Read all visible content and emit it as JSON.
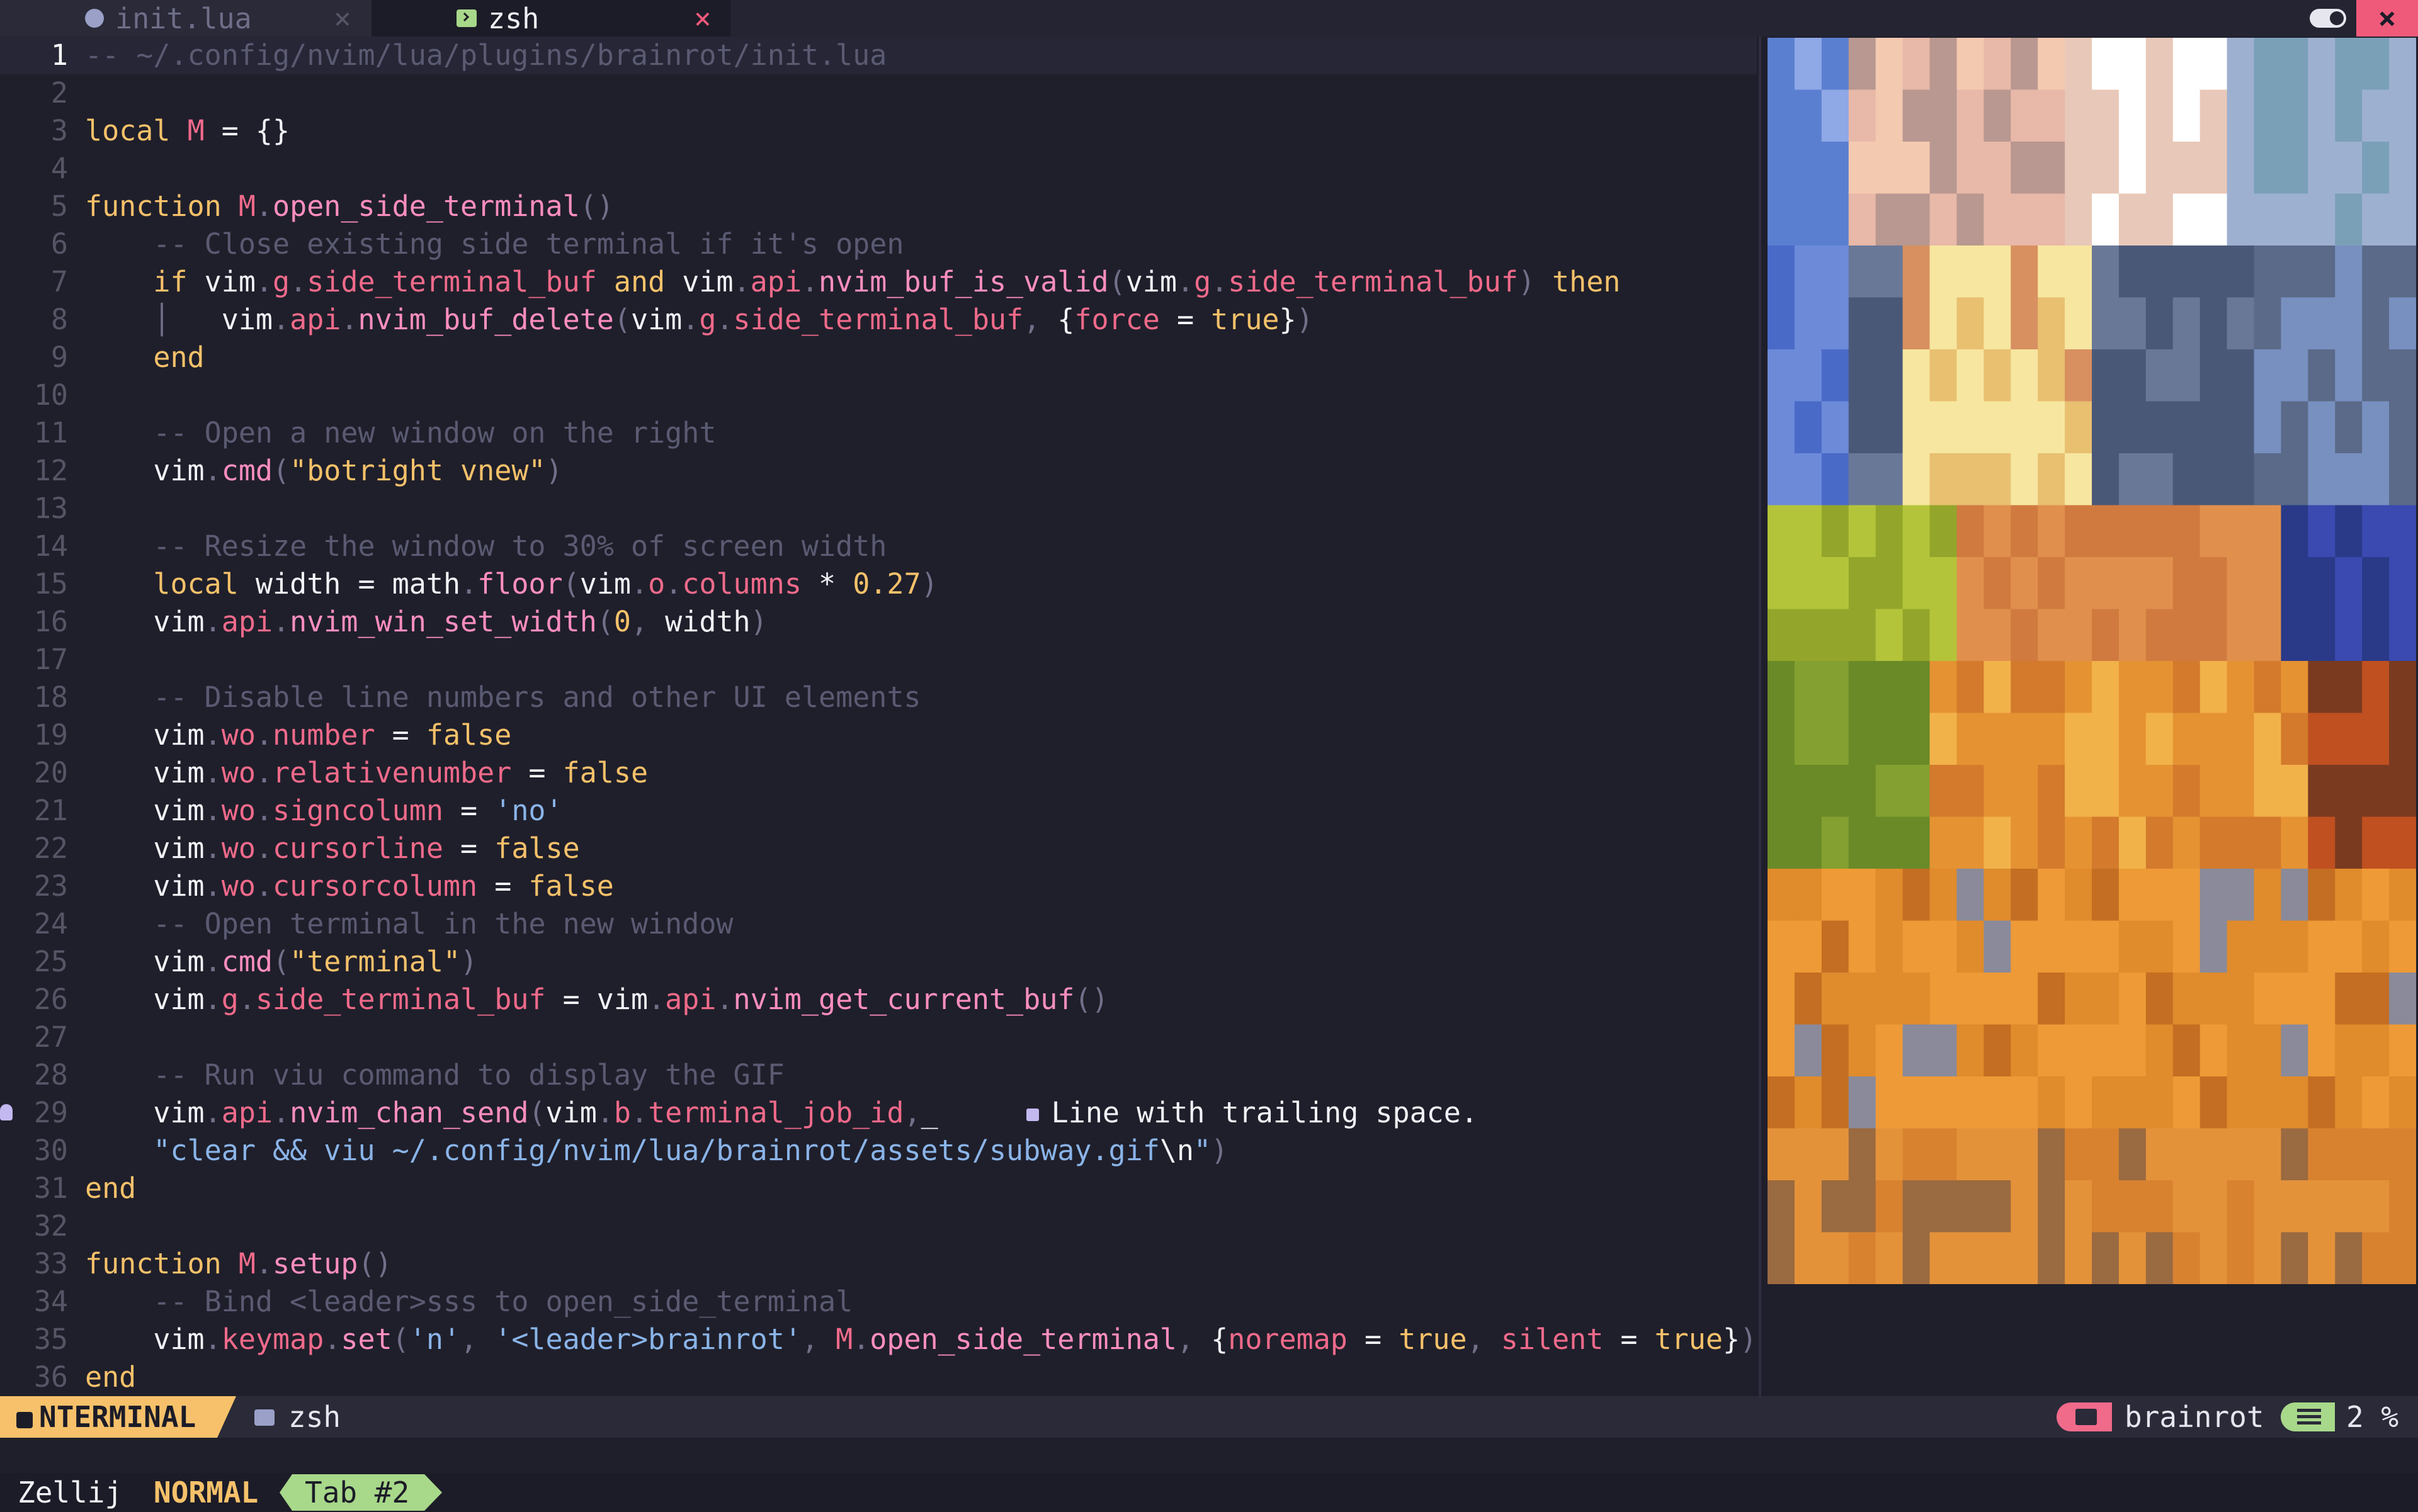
{
  "tabs": [
    {
      "label": "init.lua",
      "icon": "lua-icon",
      "close": "×",
      "active": false
    },
    {
      "label": "zsh",
      "icon": "terminal-icon",
      "close": "×",
      "active": true
    }
  ],
  "window_close": "×",
  "cursor_line": "1",
  "code_lines": [
    {
      "n": "1",
      "tokens": [
        [
          "c",
          "-- ~/.config/nvim/lua/plugins/brainrot/init.lua"
        ]
      ]
    },
    {
      "n": "2",
      "tokens": []
    },
    {
      "n": "3",
      "tokens": [
        [
          "k",
          "local"
        ],
        [
          "i",
          " "
        ],
        [
          "p",
          "M"
        ],
        [
          "i",
          " = {}"
        ]
      ]
    },
    {
      "n": "4",
      "tokens": []
    },
    {
      "n": "5",
      "tokens": [
        [
          "k",
          "function"
        ],
        [
          "i",
          " "
        ],
        [
          "p",
          "M"
        ],
        [
          "b",
          "."
        ],
        [
          "f",
          "open_side_terminal"
        ],
        [
          "b",
          "()"
        ]
      ]
    },
    {
      "n": "6",
      "tokens": [
        [
          "i",
          "    "
        ],
        [
          "c",
          "-- Close existing side terminal if it's open"
        ]
      ]
    },
    {
      "n": "7",
      "tokens": [
        [
          "i",
          "    "
        ],
        [
          "k",
          "if"
        ],
        [
          "i",
          " vim"
        ],
        [
          "b",
          "."
        ],
        [
          "p",
          "g"
        ],
        [
          "b",
          "."
        ],
        [
          "p",
          "side_terminal_buf"
        ],
        [
          "i",
          " "
        ],
        [
          "k",
          "and"
        ],
        [
          "i",
          " vim"
        ],
        [
          "b",
          "."
        ],
        [
          "p",
          "api"
        ],
        [
          "b",
          "."
        ],
        [
          "f",
          "nvim_buf_is_valid"
        ],
        [
          "b",
          "("
        ],
        [
          "i",
          "vim"
        ],
        [
          "b",
          "."
        ],
        [
          "p",
          "g"
        ],
        [
          "b",
          "."
        ],
        [
          "p",
          "side_terminal_buf"
        ],
        [
          "b",
          ")"
        ],
        [
          "i",
          " "
        ],
        [
          "k",
          "then"
        ]
      ]
    },
    {
      "n": "8",
      "tokens": [
        [
          "i",
          "    "
        ],
        [
          "b",
          "│"
        ],
        [
          "i",
          "   vim"
        ],
        [
          "b",
          "."
        ],
        [
          "p",
          "api"
        ],
        [
          "b",
          "."
        ],
        [
          "f",
          "nvim_buf_delete"
        ],
        [
          "b",
          "("
        ],
        [
          "i",
          "vim"
        ],
        [
          "b",
          "."
        ],
        [
          "p",
          "g"
        ],
        [
          "b",
          "."
        ],
        [
          "p",
          "side_terminal_buf"
        ],
        [
          "b",
          ","
        ],
        [
          "i",
          " {"
        ],
        [
          "p",
          "force"
        ],
        [
          "i",
          " = "
        ],
        [
          "k",
          "true"
        ],
        [
          "i",
          "}"
        ],
        [
          "b",
          ")"
        ]
      ]
    },
    {
      "n": "9",
      "tokens": [
        [
          "i",
          "    "
        ],
        [
          "k",
          "end"
        ]
      ]
    },
    {
      "n": "10",
      "tokens": []
    },
    {
      "n": "11",
      "tokens": [
        [
          "i",
          "    "
        ],
        [
          "c",
          "-- Open a new window on the right"
        ]
      ]
    },
    {
      "n": "12",
      "tokens": [
        [
          "i",
          "    vim"
        ],
        [
          "b",
          "."
        ],
        [
          "f",
          "cmd"
        ],
        [
          "b",
          "("
        ],
        [
          "s",
          "\"botright vnew\""
        ],
        [
          "b",
          ")"
        ]
      ]
    },
    {
      "n": "13",
      "tokens": []
    },
    {
      "n": "14",
      "tokens": [
        [
          "i",
          "    "
        ],
        [
          "c",
          "-- Resize the window to 30% of screen width"
        ]
      ]
    },
    {
      "n": "15",
      "tokens": [
        [
          "i",
          "    "
        ],
        [
          "k",
          "local"
        ],
        [
          "i",
          " width = "
        ],
        [
          "i",
          "math"
        ],
        [
          "b",
          "."
        ],
        [
          "f",
          "floor"
        ],
        [
          "b",
          "("
        ],
        [
          "i",
          "vim"
        ],
        [
          "b",
          "."
        ],
        [
          "p",
          "o"
        ],
        [
          "b",
          "."
        ],
        [
          "p",
          "columns"
        ],
        [
          "i",
          " * "
        ],
        [
          "k",
          "0.27"
        ],
        [
          "b",
          ")"
        ]
      ]
    },
    {
      "n": "16",
      "tokens": [
        [
          "i",
          "    vim"
        ],
        [
          "b",
          "."
        ],
        [
          "p",
          "api"
        ],
        [
          "b",
          "."
        ],
        [
          "f",
          "nvim_win_set_width"
        ],
        [
          "b",
          "("
        ],
        [
          "k",
          "0"
        ],
        [
          "b",
          ","
        ],
        [
          "i",
          " width"
        ],
        [
          "b",
          ")"
        ]
      ]
    },
    {
      "n": "17",
      "tokens": []
    },
    {
      "n": "18",
      "tokens": [
        [
          "i",
          "    "
        ],
        [
          "c",
          "-- Disable line numbers and other UI elements"
        ]
      ]
    },
    {
      "n": "19",
      "tokens": [
        [
          "i",
          "    vim"
        ],
        [
          "b",
          "."
        ],
        [
          "p",
          "wo"
        ],
        [
          "b",
          "."
        ],
        [
          "p",
          "number"
        ],
        [
          "i",
          " = "
        ],
        [
          "k",
          "false"
        ]
      ]
    },
    {
      "n": "20",
      "tokens": [
        [
          "i",
          "    vim"
        ],
        [
          "b",
          "."
        ],
        [
          "p",
          "wo"
        ],
        [
          "b",
          "."
        ],
        [
          "p",
          "relativenumber"
        ],
        [
          "i",
          " = "
        ],
        [
          "k",
          "false"
        ]
      ]
    },
    {
      "n": "21",
      "tokens": [
        [
          "i",
          "    vim"
        ],
        [
          "b",
          "."
        ],
        [
          "p",
          "wo"
        ],
        [
          "b",
          "."
        ],
        [
          "p",
          "signcolumn"
        ],
        [
          "i",
          " = "
        ],
        [
          "t",
          "'no'"
        ]
      ]
    },
    {
      "n": "22",
      "tokens": [
        [
          "i",
          "    vim"
        ],
        [
          "b",
          "."
        ],
        [
          "p",
          "wo"
        ],
        [
          "b",
          "."
        ],
        [
          "p",
          "cursorline"
        ],
        [
          "i",
          " = "
        ],
        [
          "k",
          "false"
        ]
      ]
    },
    {
      "n": "23",
      "tokens": [
        [
          "i",
          "    vim"
        ],
        [
          "b",
          "."
        ],
        [
          "p",
          "wo"
        ],
        [
          "b",
          "."
        ],
        [
          "p",
          "cursorcolumn"
        ],
        [
          "i",
          " = "
        ],
        [
          "k",
          "false"
        ]
      ]
    },
    {
      "n": "24",
      "tokens": [
        [
          "i",
          "    "
        ],
        [
          "c",
          "-- Open terminal in the new window"
        ]
      ]
    },
    {
      "n": "25",
      "tokens": [
        [
          "i",
          "    vim"
        ],
        [
          "b",
          "."
        ],
        [
          "f",
          "cmd"
        ],
        [
          "b",
          "("
        ],
        [
          "s",
          "\"terminal\""
        ],
        [
          "b",
          ")"
        ]
      ]
    },
    {
      "n": "26",
      "tokens": [
        [
          "i",
          "    vim"
        ],
        [
          "b",
          "."
        ],
        [
          "p",
          "g"
        ],
        [
          "b",
          "."
        ],
        [
          "p",
          "side_terminal_buf"
        ],
        [
          "i",
          " = vim"
        ],
        [
          "b",
          "."
        ],
        [
          "p",
          "api"
        ],
        [
          "b",
          "."
        ],
        [
          "f",
          "nvim_get_current_buf"
        ],
        [
          "b",
          "()"
        ]
      ]
    },
    {
      "n": "27",
      "tokens": []
    },
    {
      "n": "28",
      "tokens": [
        [
          "i",
          "    "
        ],
        [
          "c",
          "-- Run viu command to display the GIF"
        ]
      ]
    },
    {
      "n": "29",
      "tokens": [
        [
          "i",
          "    vim"
        ],
        [
          "b",
          "."
        ],
        [
          "p",
          "api"
        ],
        [
          "b",
          "."
        ],
        [
          "f",
          "nvim_chan_send"
        ],
        [
          "b",
          "("
        ],
        [
          "i",
          "vim"
        ],
        [
          "b",
          "."
        ],
        [
          "p",
          "b"
        ],
        [
          "b",
          "."
        ],
        [
          "p",
          "terminal_job_id"
        ],
        [
          "b",
          ","
        ],
        [
          "i",
          "_"
        ]
      ],
      "diagnostic": "Line with trailing space.",
      "bulb": true
    },
    {
      "n": "30",
      "tokens": [
        [
          "i",
          "    "
        ],
        [
          "t",
          "\"clear && viu ~/.config/nvim/lua/brainrot/assets/subway.gif"
        ],
        [
          "i",
          "\\n"
        ],
        [
          "t",
          "\""
        ],
        [
          "b",
          ")"
        ]
      ]
    },
    {
      "n": "31",
      "tokens": [
        [
          "k",
          "end"
        ]
      ]
    },
    {
      "n": "32",
      "tokens": []
    },
    {
      "n": "33",
      "tokens": [
        [
          "k",
          "function"
        ],
        [
          "i",
          " "
        ],
        [
          "p",
          "M"
        ],
        [
          "b",
          "."
        ],
        [
          "f",
          "setup"
        ],
        [
          "b",
          "()"
        ]
      ]
    },
    {
      "n": "34",
      "tokens": [
        [
          "i",
          "    "
        ],
        [
          "c",
          "-- Bind <leader>sss to open_side_terminal"
        ]
      ]
    },
    {
      "n": "35",
      "tokens": [
        [
          "i",
          "    vim"
        ],
        [
          "b",
          "."
        ],
        [
          "p",
          "keymap"
        ],
        [
          "b",
          "."
        ],
        [
          "f",
          "set"
        ],
        [
          "b",
          "("
        ],
        [
          "t",
          "'n'"
        ],
        [
          "b",
          ","
        ],
        [
          "i",
          " "
        ],
        [
          "t",
          "'<leader>brainrot'"
        ],
        [
          "b",
          ","
        ],
        [
          "i",
          " "
        ],
        [
          "p",
          "M"
        ],
        [
          "b",
          "."
        ],
        [
          "f",
          "open_side_terminal"
        ],
        [
          "b",
          ","
        ],
        [
          "i",
          " {"
        ],
        [
          "p",
          "noremap"
        ],
        [
          "i",
          " = "
        ],
        [
          "k",
          "true"
        ],
        [
          "b",
          ","
        ],
        [
          "i",
          " "
        ],
        [
          "p",
          "silent"
        ],
        [
          "i",
          " = "
        ],
        [
          "k",
          "true"
        ],
        [
          "i",
          "}"
        ],
        [
          "b",
          ")"
        ]
      ]
    },
    {
      "n": "36",
      "tokens": [
        [
          "k",
          "end"
        ]
      ]
    }
  ],
  "gif_preview": {
    "icon": "pixelated-gif-preview",
    "grid": "24x24"
  },
  "statusline": {
    "mode": "NTERMINAL",
    "buffer": "zsh",
    "directory": "brainrot",
    "progress": "2 %"
  },
  "zellij": {
    "title": "Zellij",
    "mode": "NORMAL",
    "tab": "Tab #2"
  },
  "colors": {
    "background": "#1f1f2b",
    "keyword": "#f6c16a",
    "field": "#f06a8a",
    "function": "#ff8ec0",
    "comment": "#5a5a72",
    "mode_bg": "#f6c16a",
    "tab_active": "#a8d88a",
    "close": "#f05a7a"
  }
}
